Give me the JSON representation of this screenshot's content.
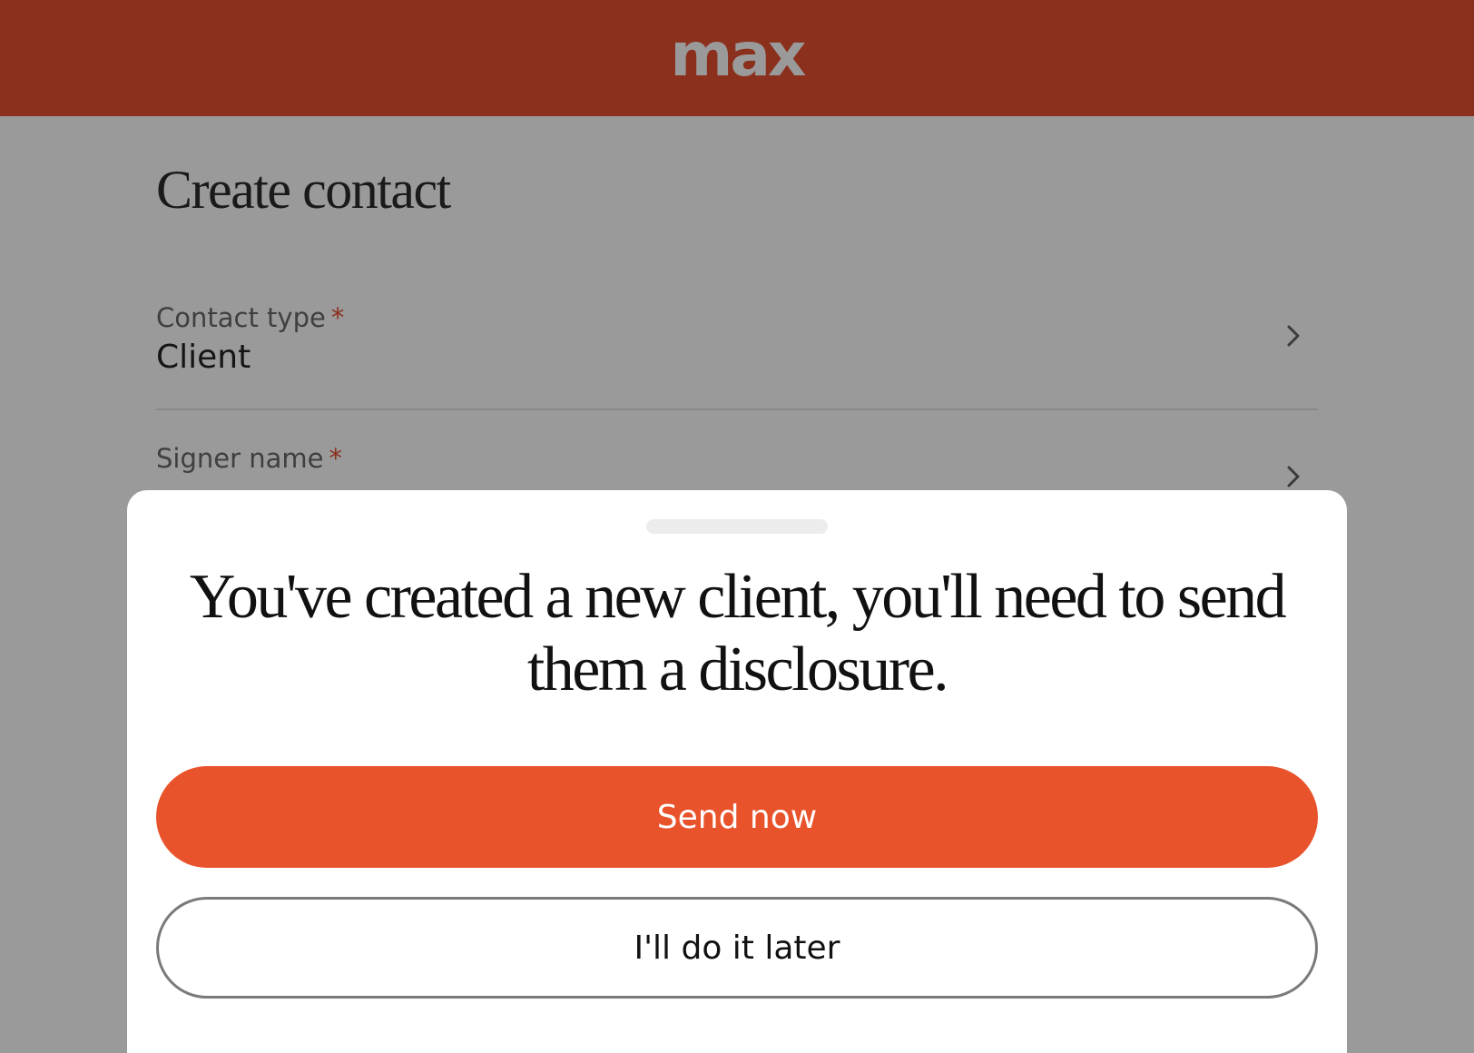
{
  "header": {
    "logo_text": "max",
    "bg_color": "#8b301d"
  },
  "page": {
    "title": "Create contact"
  },
  "fields": [
    {
      "label": "Contact type",
      "required_mark": "*",
      "value": "Client",
      "icon": "chevron-right-icon"
    },
    {
      "label": "Signer name",
      "required_mark": "*",
      "value": "",
      "icon": "chevron-right-icon"
    }
  ],
  "modal": {
    "title": "You've created a new client, you'll need to send them a disclosure.",
    "primary_button": "Send now",
    "secondary_button": "I'll do it later",
    "primary_color": "#e9532c"
  }
}
